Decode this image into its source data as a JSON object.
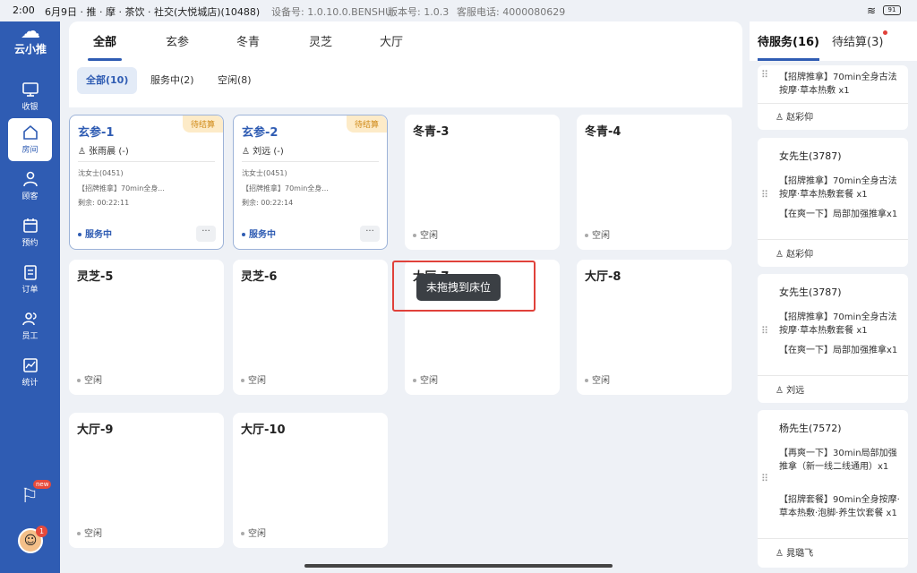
{
  "status": {
    "time": "2:00",
    "shop": "6月9日 · 推 · 摩 · 茶饮 · 社交(大悦城店)(10488)",
    "device": "设备号: 1.0.10.0.BENSHU",
    "version": "版本号: 1.0.3",
    "phone": "客服电话: 4000080629",
    "battery": "91"
  },
  "sidebar": {
    "logo_text": "云小推",
    "items": [
      {
        "label": "收银",
        "icon": "monitor-icon"
      },
      {
        "label": "房间",
        "icon": "home-icon"
      },
      {
        "label": "顾客",
        "icon": "person-icon"
      },
      {
        "label": "预约",
        "icon": "calendar-icon"
      },
      {
        "label": "订单",
        "icon": "clipboard-icon"
      },
      {
        "label": "员工",
        "icon": "group-icon"
      },
      {
        "label": "统计",
        "icon": "chart-icon"
      }
    ],
    "promo_badge": "new",
    "avatar_badge": "1"
  },
  "tabs": [
    "全部",
    "玄参",
    "冬青",
    "灵芝",
    "大厅"
  ],
  "filters": [
    "全部(10)",
    "服务中(2)",
    "空闲(8)"
  ],
  "rooms": [
    {
      "name": "玄参-1",
      "badge": "待结算",
      "staff": "张雨晨 (-)",
      "customer": "沈女士(0451)",
      "service": "【招牌推拿】70min全身...",
      "remain": "剩余: 00:22:11",
      "state": "服务中",
      "more": "···"
    },
    {
      "name": "玄参-2",
      "badge": "待结算",
      "staff": "刘远 (-)",
      "customer": "沈女士(0451)",
      "service": "【招牌推拿】70min全身...",
      "remain": "剩余: 00:22:14",
      "state": "服务中",
      "more": "···"
    },
    {
      "name": "冬青-3",
      "state": "空闲"
    },
    {
      "name": "冬青-4",
      "state": "空闲"
    },
    {
      "name": "灵芝-5",
      "state": "空闲"
    },
    {
      "name": "灵芝-6",
      "state": "空闲"
    },
    {
      "name": "大厅-7",
      "state": "空闲"
    },
    {
      "name": "大厅-8",
      "state": "空闲"
    },
    {
      "name": "大厅-9",
      "state": "空闲"
    },
    {
      "name": "大厅-10",
      "state": "空闲"
    }
  ],
  "toast": "未拖拽到床位",
  "right_tabs": [
    "待服务(16)",
    "待结算(3)"
  ],
  "orders": [
    {
      "customer": "",
      "items": [
        "【招牌推拿】70min全身古法按摩·草本热敷 x1"
      ],
      "tech": "赵彩仰"
    },
    {
      "customer": "女先生(3787)",
      "items": [
        "【招牌推拿】70min全身古法按摩·草本热敷套餐 x1",
        "【在爽一下】局部加强推拿x1"
      ],
      "tech": "赵彩仰"
    },
    {
      "customer": "女先生(3787)",
      "items": [
        "【招牌推拿】70min全身古法按摩·草本热敷套餐 x1",
        "【在爽一下】局部加强推拿x1"
      ],
      "tech": "刘远"
    },
    {
      "customer": "杨先生(7572)",
      "items": [
        "【再爽一下】30min局部加强推拿（新一线二线通用）x1",
        "【招牌套餐】90min全身按摩·草本热敷·泡脚·养生饮套餐 x1"
      ],
      "tech": "晁璐飞"
    }
  ]
}
